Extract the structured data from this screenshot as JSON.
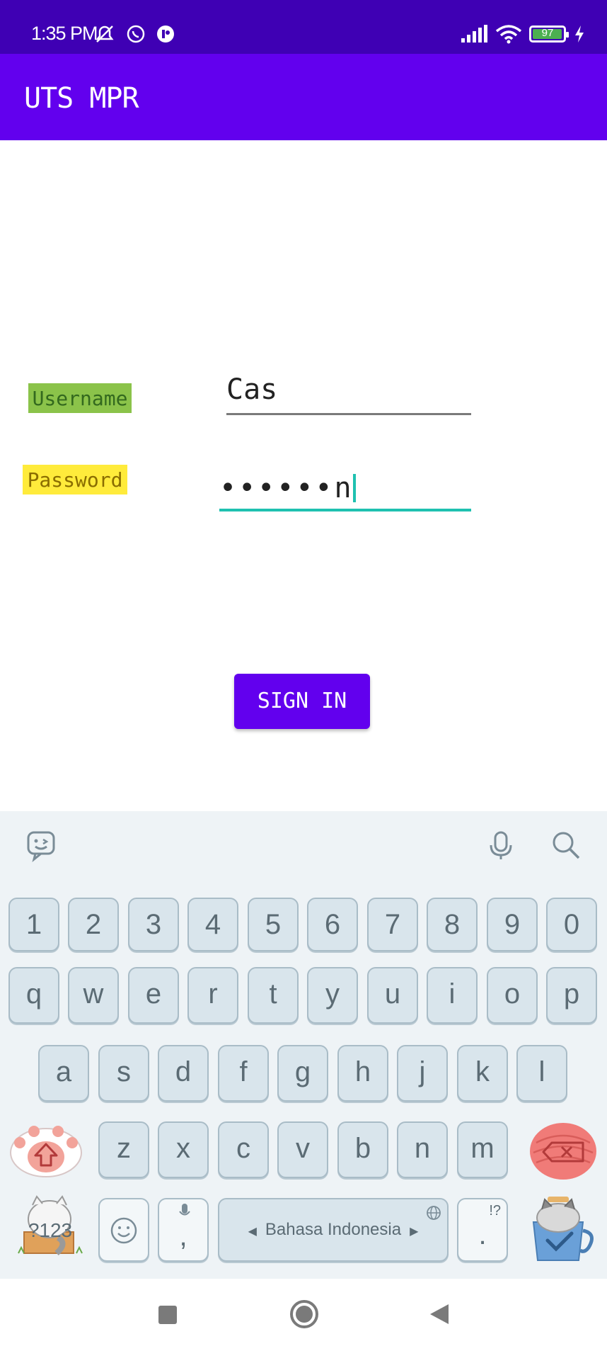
{
  "status_bar": {
    "time": "1:35 PM",
    "battery": "97",
    "icons": [
      "mute-icon",
      "whatsapp-icon",
      "app-icon",
      "signal-icon",
      "wifi-icon",
      "battery-icon",
      "charging-icon"
    ]
  },
  "app_bar": {
    "title": "UTS MPR"
  },
  "form": {
    "username_label": "Username",
    "username_value": "Cas",
    "password_label": "Password",
    "password_masked": "••••••",
    "password_last_char": "n",
    "signin_label": "SIGN IN"
  },
  "keyboard": {
    "number_row": [
      "1",
      "2",
      "3",
      "4",
      "5",
      "6",
      "7",
      "8",
      "9",
      "0"
    ],
    "row1": [
      "q",
      "w",
      "e",
      "r",
      "t",
      "y",
      "u",
      "i",
      "o",
      "p"
    ],
    "row2": [
      "a",
      "s",
      "d",
      "f",
      "g",
      "h",
      "j",
      "k",
      "l"
    ],
    "row3": [
      "z",
      "x",
      "c",
      "v",
      "b",
      "n",
      "m"
    ],
    "symbols_key": "?123",
    "comma_key": ",",
    "period_key": ".",
    "period_hint": "!?",
    "space_label": "Bahasa Indonesia"
  },
  "colors": {
    "status_bar": "#3f00b4",
    "app_bar": "#6200ee",
    "accent": "#1fc1b0",
    "username_bg": "#8bc34a",
    "password_bg": "#ffeb3b"
  }
}
